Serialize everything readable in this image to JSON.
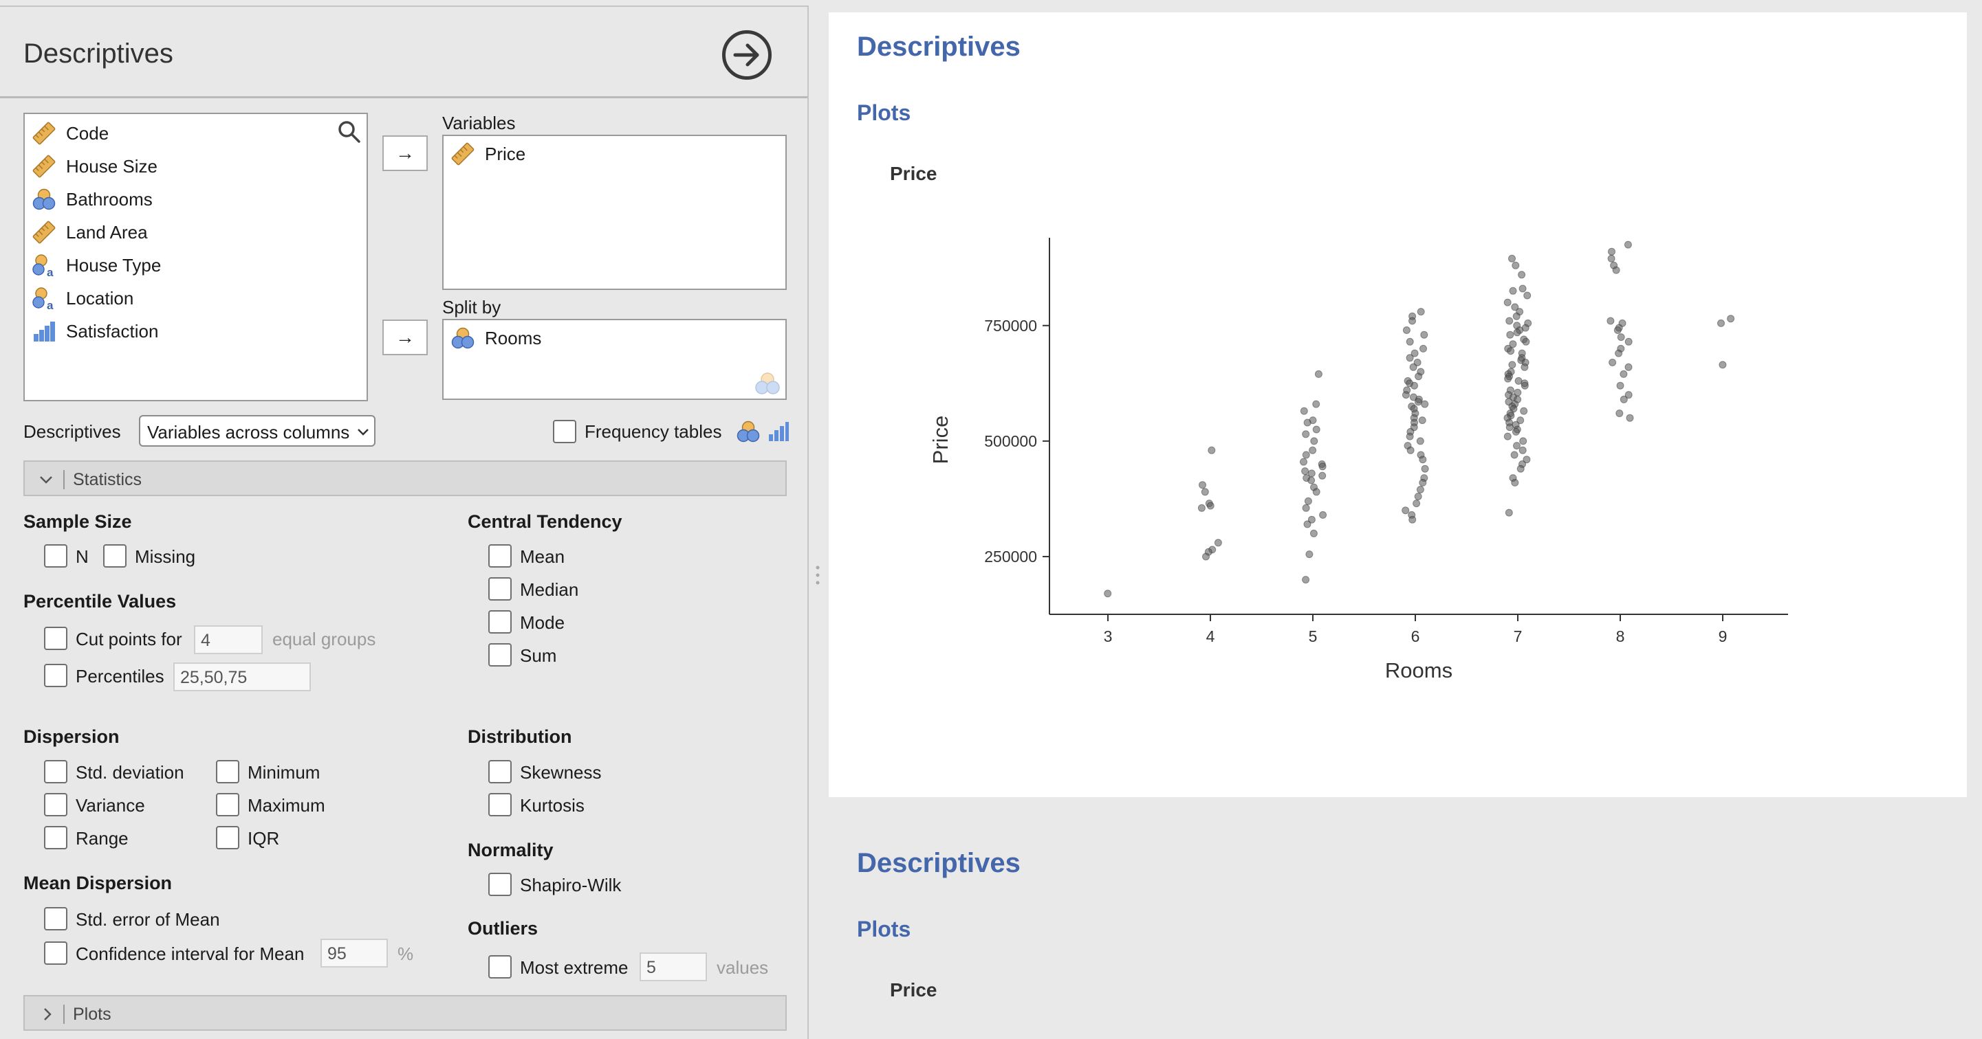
{
  "analysis_panel": {
    "title": "Descriptives",
    "variables_available": [
      {
        "name": "Code",
        "icon": "continuous-ruler-icon"
      },
      {
        "name": "House Size",
        "icon": "continuous-ruler-icon"
      },
      {
        "name": "Bathrooms",
        "icon": "nominal-circles-icon"
      },
      {
        "name": "Land Area",
        "icon": "continuous-ruler-icon"
      },
      {
        "name": "House Type",
        "icon": "nominal-text-icon"
      },
      {
        "name": "Location",
        "icon": "nominal-text-icon"
      },
      {
        "name": "Satisfaction",
        "icon": "ordinal-bars-icon"
      }
    ],
    "variables_label": "Variables",
    "variables_selected": [
      {
        "name": "Price",
        "icon": "continuous-ruler-icon"
      }
    ],
    "split_by_label": "Split by",
    "split_by_selected": [
      {
        "name": "Rooms",
        "icon": "nominal-circles-icon"
      }
    ],
    "descriptives_label": "Descriptives",
    "descriptives_mode": "Variables across columns",
    "frequency_tables_label": "Frequency tables",
    "statistics_section": "Statistics",
    "plots_section": "Plots",
    "sample_size": {
      "heading": "Sample Size",
      "n": "N",
      "missing": "Missing"
    },
    "percentile_values": {
      "heading": "Percentile Values",
      "cut_points_label": "Cut points for",
      "cut_points_value": "4",
      "equal_groups": "equal groups",
      "percentiles_label": "Percentiles",
      "percentiles_value": "25,50,75"
    },
    "central_tendency": {
      "heading": "Central Tendency",
      "items": [
        "Mean",
        "Median",
        "Mode",
        "Sum"
      ]
    },
    "dispersion": {
      "heading": "Dispersion",
      "std_deviation": "Std. deviation",
      "minimum": "Minimum",
      "variance": "Variance",
      "maximum": "Maximum",
      "range": "Range",
      "iqr": "IQR"
    },
    "distribution": {
      "heading": "Distribution",
      "skewness": "Skewness",
      "kurtosis": "Kurtosis"
    },
    "normality": {
      "heading": "Normality",
      "shapiro_wilk": "Shapiro-Wilk"
    },
    "mean_dispersion": {
      "heading": "Mean Dispersion",
      "se_mean": "Std. error of Mean",
      "ci_mean_label": "Confidence interval for Mean",
      "ci_value": "95",
      "percent": "%"
    },
    "outliers": {
      "heading": "Outliers",
      "most_extreme_label": "Most extreme",
      "most_extreme_value": "5",
      "values_unit": "values"
    }
  },
  "results": {
    "block1": {
      "title": "Descriptives",
      "plots": "Plots",
      "variable": "Price"
    },
    "block2": {
      "title": "Descriptives",
      "plots": "Plots",
      "variable": "Price"
    }
  },
  "colors": {
    "accent_blue": "#4466aa",
    "point_color": "#555555",
    "ruler": "#e9b353"
  },
  "chart_data": {
    "type": "scatter",
    "xlabel": "Rooms",
    "ylabel": "Price",
    "categories": [
      "3",
      "4",
      "5",
      "6",
      "7",
      "8",
      "9"
    ],
    "yticks": [
      250000,
      500000,
      750000
    ],
    "ylim": [
      125000,
      940000
    ],
    "jittered": true,
    "points_by_category": [
      {
        "rooms": "3",
        "prices": [
          170000
        ]
      },
      {
        "rooms": "4",
        "prices": [
          480000,
          405000,
          390000,
          365000,
          360000,
          355000,
          280000,
          265000,
          260000,
          250000
        ]
      },
      {
        "rooms": "5",
        "prices": [
          645000,
          580000,
          565000,
          545000,
          540000,
          525000,
          515000,
          500000,
          480000,
          470000,
          455000,
          450000,
          445000,
          435000,
          430000,
          425000,
          420000,
          415000,
          400000,
          390000,
          370000,
          355000,
          340000,
          330000,
          320000,
          300000,
          255000,
          200000
        ]
      },
      {
        "rooms": "6",
        "prices": [
          780000,
          770000,
          760000,
          740000,
          730000,
          715000,
          700000,
          690000,
          680000,
          670000,
          660000,
          650000,
          640000,
          630000,
          625000,
          620000,
          610000,
          600000,
          595000,
          590000,
          585000,
          580000,
          575000,
          570000,
          560000,
          550000,
          545000,
          540000,
          530000,
          520000,
          510000,
          500000,
          490000,
          480000,
          470000,
          460000,
          440000,
          420000,
          410000,
          395000,
          380000,
          365000,
          350000,
          340000,
          330000
        ]
      },
      {
        "rooms": "7",
        "prices": [
          895000,
          880000,
          860000,
          830000,
          825000,
          815000,
          800000,
          790000,
          780000,
          770000,
          760000,
          755000,
          750000,
          745000,
          740000,
          735000,
          730000,
          720000,
          715000,
          710000,
          700000,
          695000,
          690000,
          680000,
          675000,
          670000,
          665000,
          660000,
          650000,
          645000,
          640000,
          635000,
          630000,
          625000,
          620000,
          610000,
          605000,
          600000,
          595000,
          590000,
          585000,
          580000,
          575000,
          570000,
          565000,
          560000,
          555000,
          550000,
          545000,
          540000,
          535000,
          530000,
          525000,
          520000,
          510000,
          500000,
          490000,
          480000,
          470000,
          460000,
          450000,
          440000,
          420000,
          410000,
          345000
        ]
      },
      {
        "rooms": "8",
        "prices": [
          925000,
          910000,
          895000,
          880000,
          870000,
          760000,
          755000,
          745000,
          740000,
          725000,
          715000,
          700000,
          690000,
          670000,
          660000,
          645000,
          620000,
          600000,
          590000,
          560000,
          550000
        ]
      },
      {
        "rooms": "9",
        "prices": [
          765000,
          755000,
          665000
        ]
      }
    ]
  }
}
